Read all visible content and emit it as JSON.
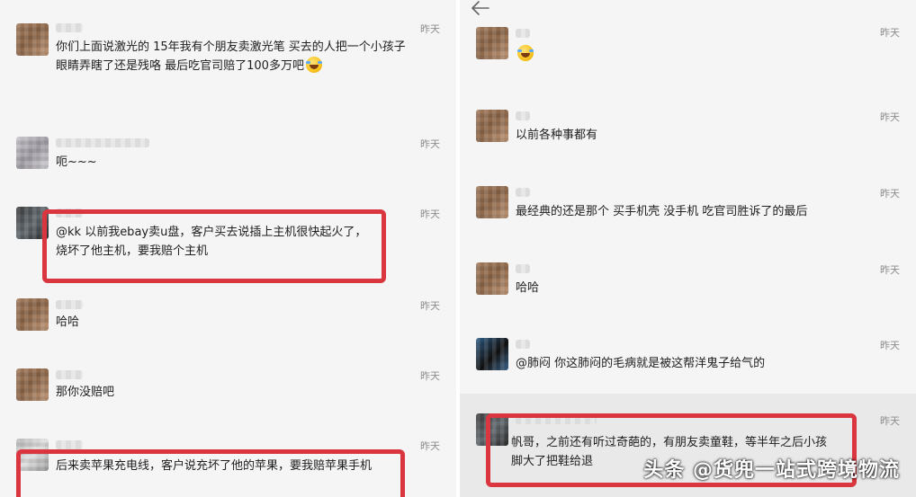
{
  "left_panel": {
    "messages": [
      {
        "time": "昨天",
        "text": "你们上面说激光的 15年我有个朋友卖激光笔 买去的人把一个小孩子眼睛弄瞎了还是残咯 最后吃官司赔了100多万吧",
        "emoji": "laughing-crying-emoji"
      },
      {
        "time": "昨天",
        "text": "呃~~~"
      },
      {
        "time": "昨天",
        "text": "@kk 以前我ebay卖u盘，客户买去说插上主机很快起火了，烧坏了他主机，要我赔个主机"
      },
      {
        "time": "昨天",
        "text": "哈哈"
      },
      {
        "time": "昨天",
        "text": "那你没赔吧"
      },
      {
        "time": "昨天",
        "text": "后来卖苹果充电线，客户说充坏了他的苹果，要我赔苹果手机"
      }
    ]
  },
  "right_panel": {
    "back_icon": "back-arrow-icon",
    "messages": [
      {
        "time": "昨天",
        "text": "",
        "emoji": "laughing-crying-emoji"
      },
      {
        "time": "昨天",
        "text": "以前各种事都有"
      },
      {
        "time": "昨天",
        "text": "最经典的还是那个 买手机壳 没手机 吃官司胜诉了的最后"
      },
      {
        "time": "昨天",
        "text": "哈哈"
      },
      {
        "time": "昨天",
        "text": "@肺闷   你这肺闷的毛病就是被这帮洋鬼子给气的"
      },
      {
        "time": "昨天",
        "text": "帆哥，之前还有听过奇葩的，有朋友卖童鞋，等半年之后小孩脚大了把鞋给退"
      }
    ]
  },
  "watermark": "头条 @货兜一站式跨境物流",
  "colors": {
    "highlight_box": "#d9363f",
    "background": "#f5f5f5"
  }
}
